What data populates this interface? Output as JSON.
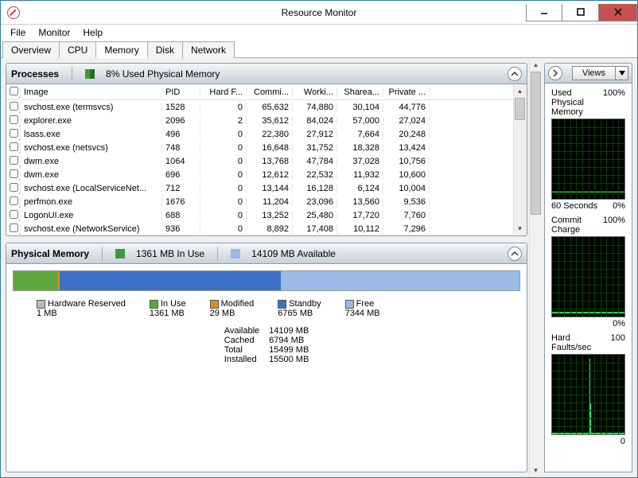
{
  "window": {
    "title": "Resource Monitor"
  },
  "menu": {
    "file": "File",
    "monitor": "Monitor",
    "help": "Help"
  },
  "tabs": {
    "overview": "Overview",
    "cpu": "CPU",
    "memory": "Memory",
    "disk": "Disk",
    "network": "Network"
  },
  "processes": {
    "title": "Processes",
    "summary": "8% Used Physical Memory",
    "columns": {
      "image": "Image",
      "pid": "PID",
      "hard": "Hard F...",
      "commit": "Commi...",
      "working": "Worki...",
      "shareable": "Sharea...",
      "private": "Private ..."
    },
    "rows": [
      {
        "image": "svchost.exe (termsvcs)",
        "pid": "1528",
        "hard": "0",
        "commit": "65,632",
        "working": "74,880",
        "shareable": "30,104",
        "private": "44,776"
      },
      {
        "image": "explorer.exe",
        "pid": "2096",
        "hard": "2",
        "commit": "35,612",
        "working": "84,024",
        "shareable": "57,000",
        "private": "27,024"
      },
      {
        "image": "lsass.exe",
        "pid": "496",
        "hard": "0",
        "commit": "22,380",
        "working": "27,912",
        "shareable": "7,664",
        "private": "20,248"
      },
      {
        "image": "svchost.exe (netsvcs)",
        "pid": "748",
        "hard": "0",
        "commit": "16,648",
        "working": "31,752",
        "shareable": "18,328",
        "private": "13,424"
      },
      {
        "image": "dwm.exe",
        "pid": "1064",
        "hard": "0",
        "commit": "13,768",
        "working": "47,784",
        "shareable": "37,028",
        "private": "10,756"
      },
      {
        "image": "dwm.exe",
        "pid": "696",
        "hard": "0",
        "commit": "12,612",
        "working": "22,532",
        "shareable": "11,932",
        "private": "10,600"
      },
      {
        "image": "svchost.exe (LocalServiceNet...",
        "pid": "712",
        "hard": "0",
        "commit": "13,144",
        "working": "16,128",
        "shareable": "6,124",
        "private": "10,004"
      },
      {
        "image": "perfmon.exe",
        "pid": "1676",
        "hard": "0",
        "commit": "11,204",
        "working": "23,096",
        "shareable": "13,560",
        "private": "9,536"
      },
      {
        "image": "LogonUI.exe",
        "pid": "688",
        "hard": "0",
        "commit": "13,252",
        "working": "25,480",
        "shareable": "17,720",
        "private": "7,760"
      },
      {
        "image": "svchost.exe (NetworkService)",
        "pid": "936",
        "hard": "0",
        "commit": "8,892",
        "working": "17,408",
        "shareable": "10,112",
        "private": "7,296"
      }
    ]
  },
  "physmem": {
    "title": "Physical Memory",
    "inuse_label": "1361 MB In Use",
    "avail_label": "14109 MB Available",
    "legend": {
      "hw": "Hardware Reserved",
      "hw_val": "1 MB",
      "inuse": "In Use",
      "inuse_val": "1361 MB",
      "mod": "Modified",
      "mod_val": "29 MB",
      "standby": "Standby",
      "standby_val": "6765 MB",
      "free": "Free",
      "free_val": "7344 MB"
    },
    "stats": {
      "available_l": "Available",
      "available_v": "14109 MB",
      "cached_l": "Cached",
      "cached_v": "6794 MB",
      "total_l": "Total",
      "total_v": "15499 MB",
      "installed_l": "Installed",
      "installed_v": "15500 MB"
    }
  },
  "charts": {
    "views": "Views",
    "used": {
      "title": "Used Physical Memory",
      "max": "100%",
      "xlabel": "60 Seconds",
      "min": "0%"
    },
    "commit": {
      "title": "Commit Charge",
      "max": "100%",
      "min": "0%"
    },
    "hard": {
      "title": "Hard Faults/sec",
      "max": "100",
      "min": "0"
    }
  },
  "chart_data": [
    {
      "type": "line",
      "title": "Used Physical Memory",
      "ylabel": "%",
      "ylim": [
        0,
        100
      ],
      "xlim_seconds": 60,
      "series": [
        {
          "name": "used",
          "values_pct": [
            8,
            8,
            8,
            8,
            8,
            8,
            8,
            8,
            8,
            8,
            8,
            8
          ]
        }
      ]
    },
    {
      "type": "line",
      "title": "Commit Charge",
      "ylabel": "%",
      "ylim": [
        0,
        100
      ],
      "xlim_seconds": 60,
      "series": [
        {
          "name": "commit",
          "values_pct": [
            4,
            4,
            4,
            4,
            4,
            4,
            4,
            4,
            4,
            4,
            4,
            4
          ]
        }
      ]
    },
    {
      "type": "line",
      "title": "Hard Faults/sec",
      "ylabel": "faults/sec",
      "ylim": [
        0,
        100
      ],
      "xlim_seconds": 60,
      "series": [
        {
          "name": "faults",
          "values": [
            0,
            0,
            0,
            0,
            0,
            0,
            2,
            95,
            0,
            0,
            0,
            0
          ]
        }
      ]
    }
  ]
}
